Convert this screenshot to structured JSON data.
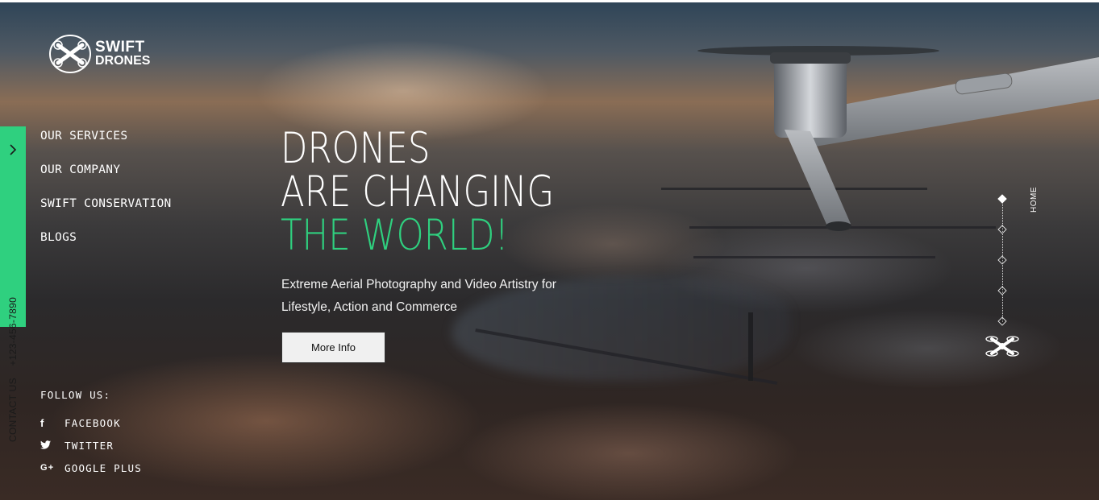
{
  "brand": {
    "line1": "SWIFT",
    "line2": "DRONES"
  },
  "contact": {
    "label": "CONTACT US",
    "phone": "+123-456-7890"
  },
  "nav": {
    "items": [
      {
        "label": "OUR SERVICES"
      },
      {
        "label": "OUR COMPANY"
      },
      {
        "label": "SWIFT CONSERVATION"
      },
      {
        "label": "BLOGS"
      }
    ]
  },
  "hero": {
    "line1": "DRONES",
    "line2": "ARE CHANGING",
    "line3": "THE WORLD!",
    "subtitle": "Extreme Aerial Photography and Video Artistry for Lifestyle, Action and Commerce",
    "button": "More Info"
  },
  "follow": {
    "label": "FOLLOW US:",
    "items": [
      {
        "icon": "facebook-icon",
        "glyph": "f",
        "label": "FACEBOOK"
      },
      {
        "icon": "twitter-icon",
        "glyph": "🐦",
        "label": "TWITTER"
      },
      {
        "icon": "google-plus-icon",
        "glyph": "G+",
        "label": "GOOGLE PLUS"
      }
    ]
  },
  "pager": {
    "label": "HOME",
    "count": 5,
    "active_index": 0
  },
  "colors": {
    "accent": "#2fd07f",
    "button_bg": "#f0f0f0"
  }
}
